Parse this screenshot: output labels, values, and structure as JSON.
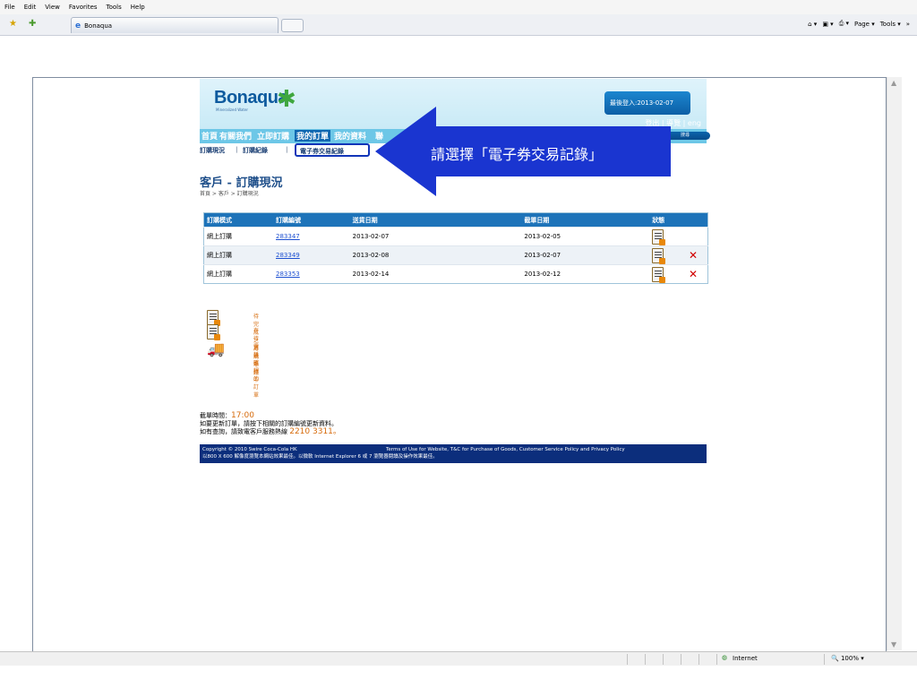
{
  "browser": {
    "menu": [
      "File",
      "Edit",
      "View",
      "Favorites",
      "Tools",
      "Help"
    ],
    "tab_title": "Bonaqua",
    "right_tools": [
      "Page ▾",
      "Tools ▾",
      "»"
    ],
    "status_zone": "Internet",
    "zoom": "100%"
  },
  "site": {
    "logo": "Bonaqua",
    "logo_sub": "Mineralized Water",
    "last_login": "最後登入:2013-02-07",
    "login_links": "登出 | 導覽 | eng",
    "nav": [
      "首頁",
      "有關我們",
      "立即訂購",
      "我的訂單",
      "我的資料",
      "聯"
    ],
    "go_button": "搜尋",
    "subnav": [
      "訂購現況",
      "訂購紀錄",
      "電子券交易紀錄"
    ],
    "callout": "請選擇「電子券交易記錄」",
    "page_title": "客戶 - 訂購現況",
    "breadcrumb": "首頁 > 客戶 > 訂購現況",
    "table_headers": [
      "訂購模式",
      "訂購編號",
      "送貨日期",
      "截單日期",
      "狀態"
    ],
    "orders": [
      {
        "mode": "網上訂購",
        "id": "283347",
        "delivery": "2013-02-07",
        "cutoff": "2013-02-05",
        "cancel": false
      },
      {
        "mode": "網上訂購",
        "id": "283349",
        "delivery": "2013-02-08",
        "cutoff": "2013-02-07",
        "cancel": true
      },
      {
        "mode": "網上訂購",
        "id": "283353",
        "delivery": "2013-02-14",
        "cutoff": "2013-02-12",
        "cancel": true
      }
    ],
    "legend": [
      "待完成之訂購申請",
      "有待電話確認的訂單",
      "送貨進行中"
    ],
    "cutoff_time_label": "截單時間：",
    "cutoff_time": "17:00",
    "note1": "如要更新訂單，請按下相關的訂購編號更新資料。",
    "note2_a": "如有查詢，請致電客戶服務熱線 ",
    "note2_b": "2210 3311。",
    "copyright": "Copyright © 2010 Swire Coca-Cola HK",
    "terms": "Terms of Use for Website, T&C for Purchase of Goods, Customer Service Policy and Privacy Policy",
    "resolution_note": "以800 X 600 解像度瀏覽本網站效果最佳。以微軟 Internet Explorer 6 或 7 瀏覽器閱讀及操作效果最佳。"
  }
}
